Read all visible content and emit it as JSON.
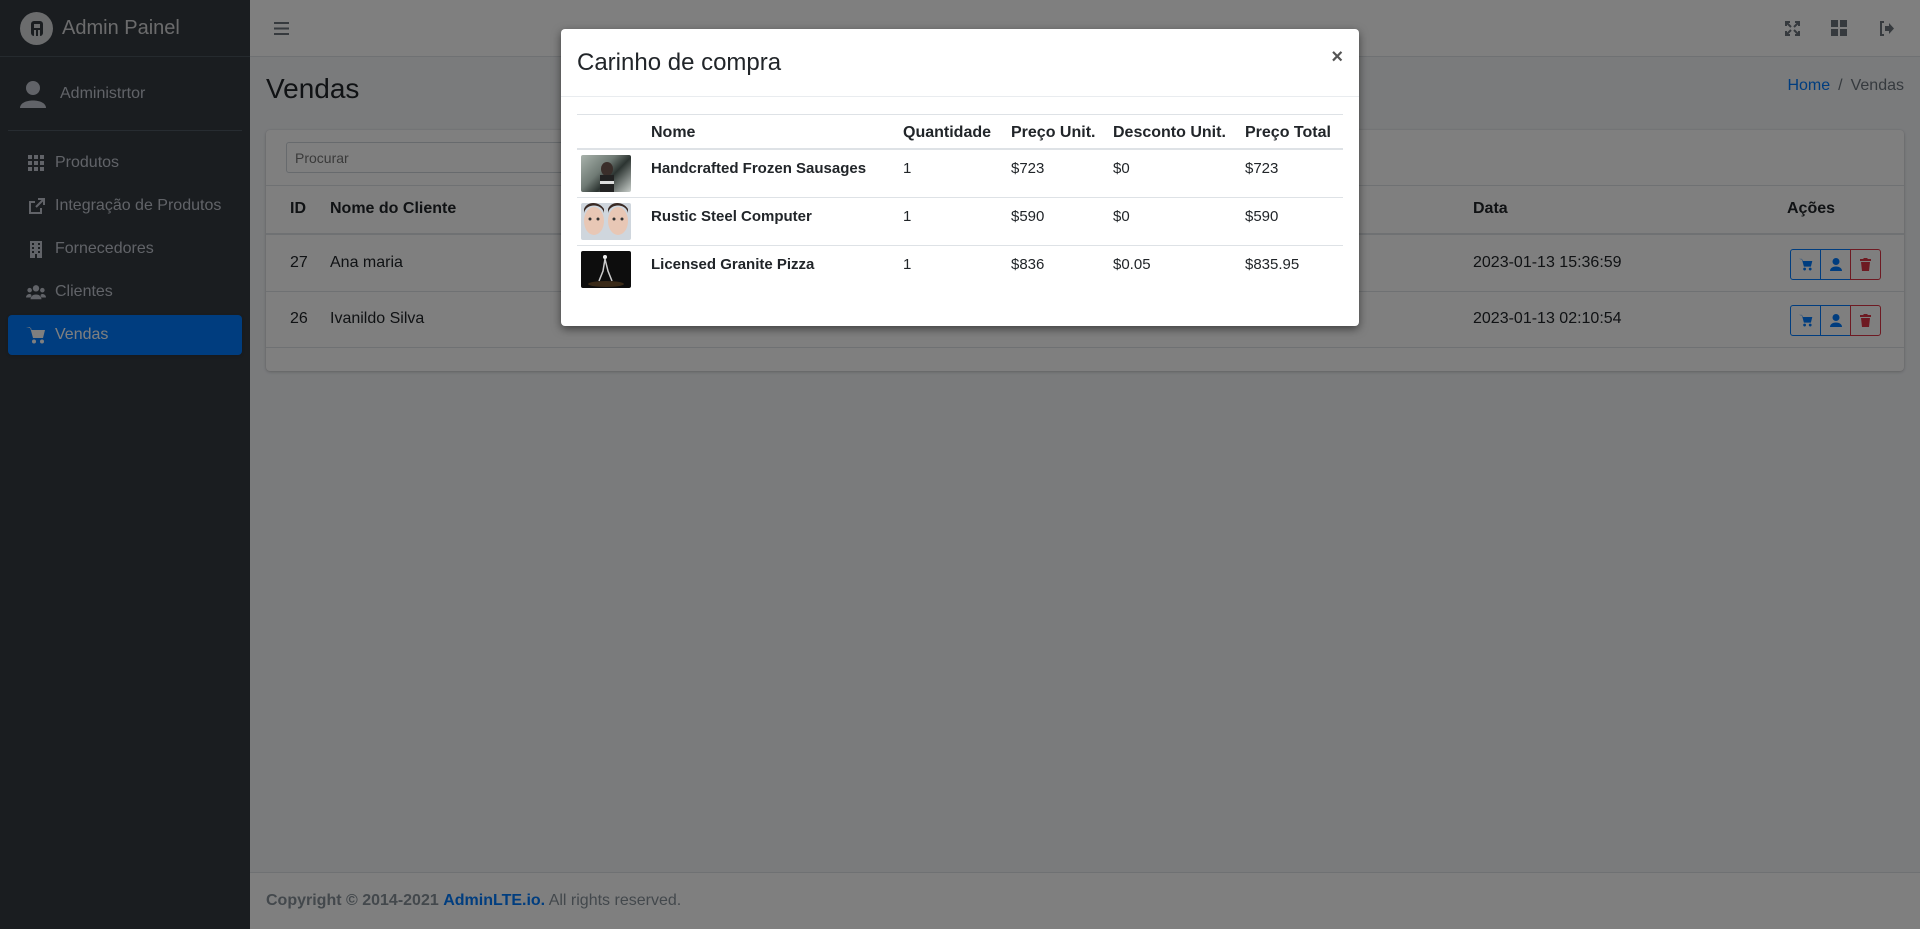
{
  "brand": {
    "name": "Admin Painel"
  },
  "user": {
    "name": "Administrtor"
  },
  "sidebar": {
    "items": [
      {
        "label": "Produtos",
        "icon": "grid-icon"
      },
      {
        "label": "Integração de Produtos",
        "icon": "external-link-icon"
      },
      {
        "label": "Fornecedores",
        "icon": "building-icon"
      },
      {
        "label": "Clientes",
        "icon": "users-icon"
      },
      {
        "label": "Vendas",
        "icon": "cart-icon",
        "active": true
      }
    ]
  },
  "page": {
    "title": "Vendas",
    "breadcrumb": {
      "home": "Home",
      "separator": "/",
      "current": "Vendas"
    }
  },
  "sales_table": {
    "search_placeholder": "Procurar",
    "headers": {
      "id": "ID",
      "client": "Nome do Cliente",
      "date": "Data",
      "actions": "Ações"
    },
    "rows": [
      {
        "id": "27",
        "client": "Ana maria",
        "date": "2023-01-13 15:36:59"
      },
      {
        "id": "26",
        "client": "Ivanildo Silva",
        "date": "2023-01-13 02:10:54"
      }
    ]
  },
  "footer": {
    "copyright": "Copyright © 2014-2021",
    "link": "AdminLTE.io.",
    "rights": "All rights reserved."
  },
  "modal": {
    "title": "Carinho de compra",
    "close": "×",
    "headers": {
      "name": "Nome",
      "qty": "Quantidade",
      "unit_price": "Preço Unit.",
      "unit_discount": "Desconto Unit.",
      "total": "Preço Total"
    },
    "items": [
      {
        "name": "Handcrafted Frozen Sausages",
        "qty": "1",
        "unit_price": "$723",
        "unit_discount": "$0",
        "total": "$723"
      },
      {
        "name": "Rustic Steel Computer",
        "qty": "1",
        "unit_price": "$590",
        "unit_discount": "$0",
        "total": "$590"
      },
      {
        "name": "Licensed Granite Pizza",
        "qty": "1",
        "unit_price": "$836",
        "unit_discount": "$0.05",
        "total": "$835.95"
      }
    ]
  },
  "colors": {
    "primary": "#007bff",
    "danger": "#dc3545",
    "sidebar_bg": "#343a40"
  }
}
